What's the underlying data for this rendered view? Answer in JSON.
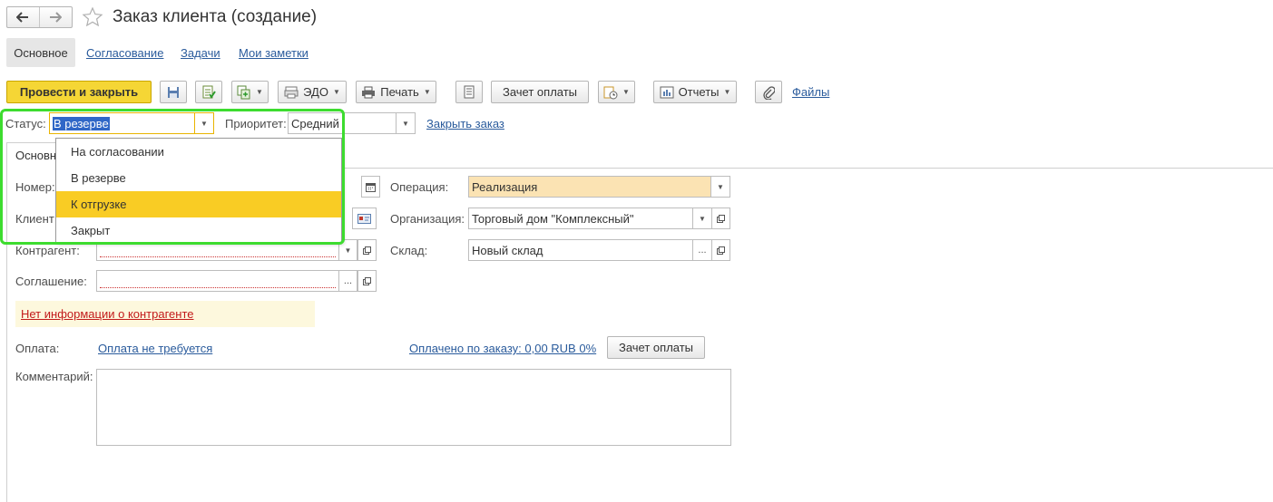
{
  "window": {
    "title": "Заказ клиента (создание)"
  },
  "tabs": [
    {
      "label": "Основное"
    },
    {
      "label": "Согласование"
    },
    {
      "label": "Задачи"
    },
    {
      "label": "Мои заметки"
    }
  ],
  "toolbar": {
    "post_and_close": "Провести и закрыть",
    "edo": "ЭДО",
    "print": "Печать",
    "offset_payment": "Зачет оплаты",
    "reports": "Отчеты",
    "files": "Файлы"
  },
  "header_row": {
    "status_label": "Статус:",
    "status_value": "В резерве",
    "priority_label": "Приоритет:",
    "priority_value": "Средний",
    "close_order": "Закрыть заказ"
  },
  "status_dropdown": {
    "options": [
      {
        "label": "На согласовании"
      },
      {
        "label": "В резерве"
      },
      {
        "label": "К отгрузке"
      },
      {
        "label": "Закрыт"
      }
    ],
    "highlighted": "К отгрузке"
  },
  "inner_tab": {
    "label": "Основн"
  },
  "form": {
    "number_label": "Номер:",
    "client_label": "Клиент",
    "counterparty_label": "Контрагент:",
    "agreement_label": "Соглашение:",
    "operation_label": "Операция:",
    "operation_value": "Реализация",
    "organization_label": "Организация:",
    "organization_value": "Торговый дом \"Комплексный\"",
    "warehouse_label": "Склад:",
    "warehouse_value": "Новый склад",
    "no_info_warning": "Нет информации о контрагенте",
    "payment_label": "Оплата:",
    "payment_value": "Оплата не требуется",
    "paid_by_order": "Оплачено по заказу: 0,00 RUB 0%",
    "offset_payment_button": "Зачет оплаты",
    "comment_label": "Комментарий:",
    "comment_value": ""
  },
  "colors": {
    "primary_button": "#f5d635",
    "highlight_row": "#f9cc24",
    "operation_field": "#fbe3b3",
    "warning_bg": "#fdf8dd",
    "annotation_outline": "#3ddc2f",
    "link": "#2a5b9c"
  }
}
